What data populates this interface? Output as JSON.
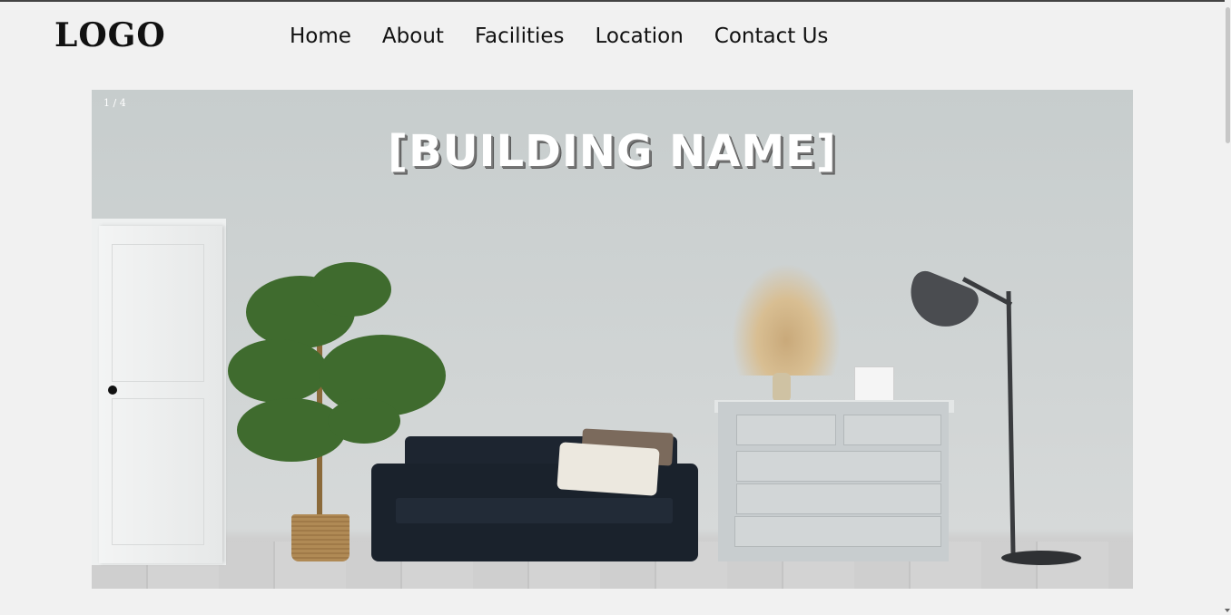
{
  "header": {
    "logo": "LOGO",
    "nav": [
      {
        "label": "Home"
      },
      {
        "label": "About"
      },
      {
        "label": "Facilities"
      },
      {
        "label": "Location"
      },
      {
        "label": "Contact Us"
      }
    ]
  },
  "slideshow": {
    "counter": "1 / 4",
    "title": "[BUILDING NAME]"
  },
  "colors": {
    "page_background": "#f1f1f1",
    "text": "#111111"
  }
}
